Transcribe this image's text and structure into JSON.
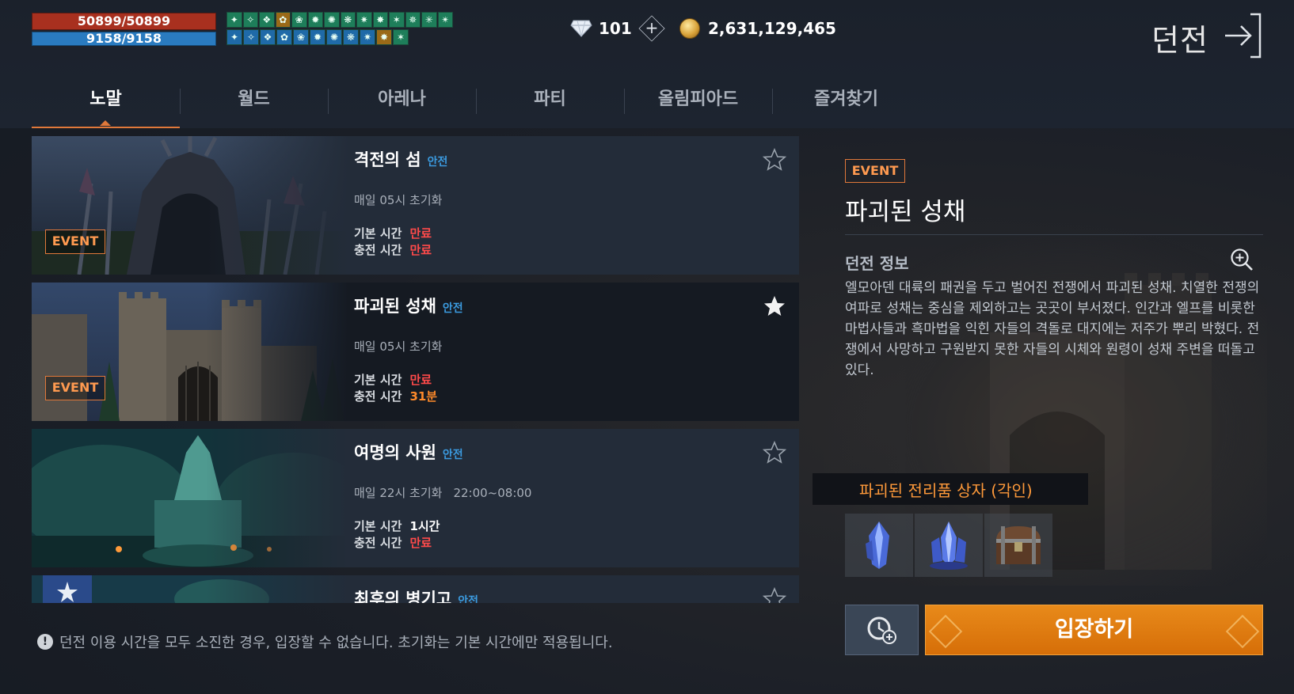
{
  "status": {
    "hp": "50899/50899",
    "mp": "9158/9158"
  },
  "buffs": {
    "row1": [
      "g",
      "g",
      "g",
      "o",
      "g",
      "g",
      "g",
      "g",
      "g",
      "g",
      "g",
      "g",
      "g",
      "g"
    ],
    "row2": [
      "b",
      "b",
      "b",
      "b",
      "b",
      "b",
      "b",
      "b",
      "b",
      "o",
      "g"
    ]
  },
  "currency": {
    "diamonds": "101",
    "gold": "2,631,129,465"
  },
  "header": {
    "title": "던전"
  },
  "tabs": [
    {
      "label": "노말",
      "active": true
    },
    {
      "label": "월드"
    },
    {
      "label": "아레나"
    },
    {
      "label": "파티"
    },
    {
      "label": "올림피아드"
    },
    {
      "label": "즐겨찾기"
    }
  ],
  "dungeons": [
    {
      "name": "격전의 섬",
      "safety": "안전",
      "event": "EVENT",
      "reset": "매일 05시 초기화",
      "window": "",
      "base_label": "기본 시간",
      "base_value": "만료",
      "charge_label": "충전 시간",
      "charge_value": "만료",
      "favorite": false
    },
    {
      "name": "파괴된 성채",
      "safety": "안전",
      "event": "EVENT",
      "reset": "매일 05시 초기화",
      "window": "",
      "base_label": "기본 시간",
      "base_value": "만료",
      "charge_label": "충전 시간",
      "charge_value": "31분",
      "favorite": true
    },
    {
      "name": "여명의 사원",
      "safety": "안전",
      "event": "",
      "reset": "매일 22시 초기화",
      "window": "22:00~08:00",
      "base_label": "기본 시간",
      "base_value": "1시간",
      "charge_label": "충전 시간",
      "charge_value": "만료",
      "favorite": false
    },
    {
      "name": "최후의 병기고",
      "safety": "안전",
      "favorite": false
    }
  ],
  "notice": "던전 이용 시간을 모두 소진한 경우, 입장할 수 없습니다. 초기화는 기본 시간에만 적용됩니다.",
  "detail": {
    "event": "EVENT",
    "title": "파괴된 성채",
    "info_label": "던전 정보",
    "description": "엘모아덴 대륙의 패권을 두고 벌어진 전쟁에서 파괴된 성채. 치열한 전쟁의 여파로 성채는 중심을 제외하고는 곳곳이 부서졌다. 인간과 엘프를 비롯한 마법사들과 흑마법을 익힌 자들의 격돌로 대지에는 저주가 뿌리 박혔다. 전쟁에서 사망하고 구원받지 못한 자들의 시체와 원령이 성채 주변을 떠돌고 있다.",
    "reward_label": "파괴된 전리품 상자 (각인)",
    "rewards": [
      "blue-crystal-icon",
      "blue-crystal-cluster-icon",
      "treasure-chest-icon"
    ],
    "enter_label": "입장하기"
  },
  "colors": {
    "accent": "#e0783a",
    "safety": "#3b9be0",
    "expired": "#ff4a4a",
    "enter": "#e07d12"
  }
}
